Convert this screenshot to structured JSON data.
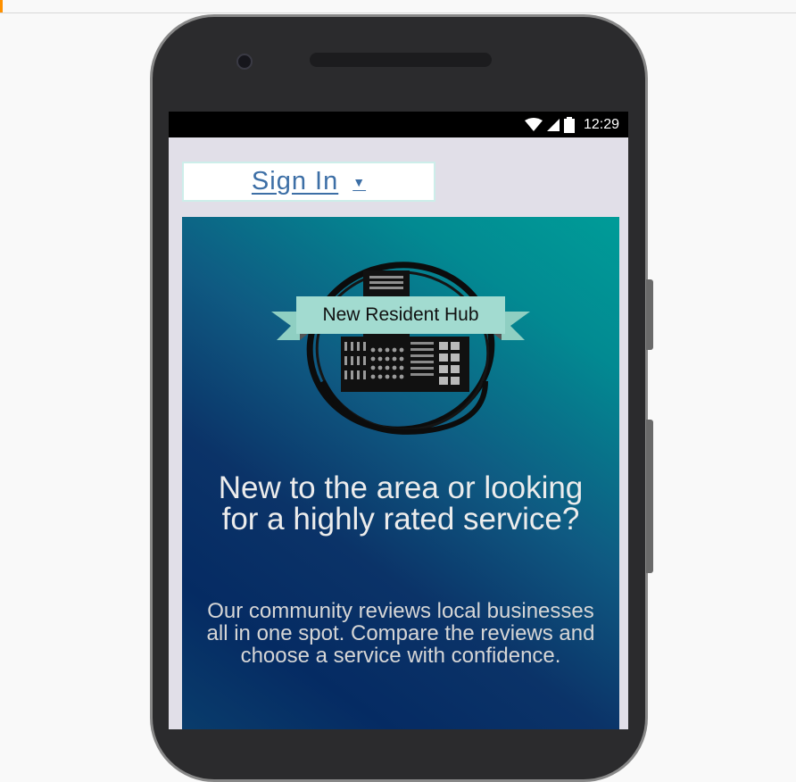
{
  "status_bar": {
    "time": "12:29",
    "icons": [
      "wifi-icon",
      "signal-icon",
      "battery-icon"
    ]
  },
  "account": {
    "signin_label": "Sign In",
    "caret": "▼"
  },
  "hero": {
    "logo_text": "New Resident Hub",
    "title": "New to the area or looking for a highly rated service?",
    "subtitle": "Our community reviews local businesses all in one spot. Compare the reviews and choose a service with confidence."
  },
  "colors": {
    "signin_link": "#3d6fa6",
    "banner": "#9ed6cc",
    "hero_dark": "#052b63",
    "hero_teal": "#009c98"
  }
}
